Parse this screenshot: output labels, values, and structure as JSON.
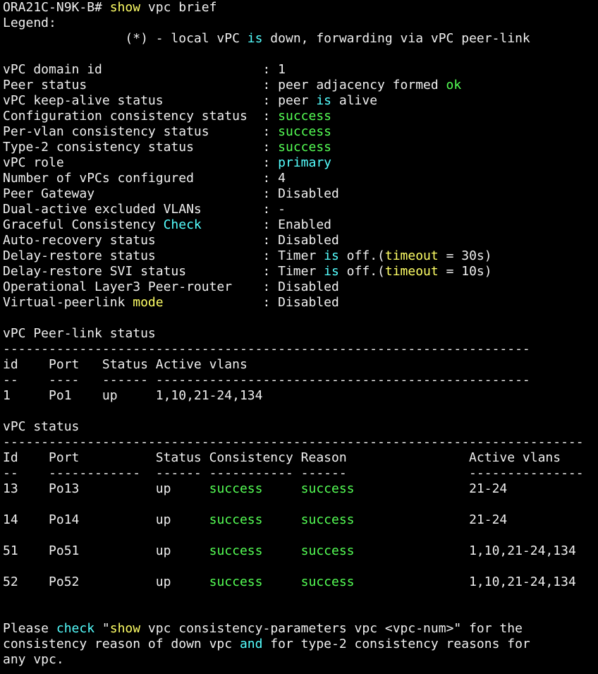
{
  "colors": {
    "background": "#000000",
    "text": "#f0f0f0",
    "keyword_yellow": "#ffff66",
    "keyword_green": "#55ff55",
    "keyword_cyan": "#55ffff"
  },
  "lines": [
    [
      {
        "t": "ORA21C-N9K-B# "
      },
      {
        "t": "show",
        "c": "y"
      },
      {
        "t": " vpc brief"
      }
    ],
    [
      {
        "t": "Legend:"
      }
    ],
    [
      {
        "t": "                (*) - local vPC "
      },
      {
        "t": "is",
        "c": "c"
      },
      {
        "t": " down, forwarding via vPC peer-link"
      }
    ],
    [
      {
        "t": ""
      }
    ],
    [
      {
        "t": "vPC domain id                     : 1"
      }
    ],
    [
      {
        "t": "Peer status                       : peer adjacency formed "
      },
      {
        "t": "ok",
        "c": "g"
      }
    ],
    [
      {
        "t": "vPC keep-alive status             : peer "
      },
      {
        "t": "is",
        "c": "c"
      },
      {
        "t": " alive"
      }
    ],
    [
      {
        "t": "Configuration consistency status  : "
      },
      {
        "t": "success",
        "c": "g"
      }
    ],
    [
      {
        "t": "Per-vlan consistency status       : "
      },
      {
        "t": "success",
        "c": "g"
      }
    ],
    [
      {
        "t": "Type-2 consistency status         : "
      },
      {
        "t": "success",
        "c": "g"
      }
    ],
    [
      {
        "t": "vPC role                          : "
      },
      {
        "t": "primary",
        "c": "c"
      }
    ],
    [
      {
        "t": "Number of vPCs configured         : 4"
      }
    ],
    [
      {
        "t": "Peer Gateway                      : Disabled"
      }
    ],
    [
      {
        "t": "Dual-active excluded VLANs        : -"
      }
    ],
    [
      {
        "t": "Graceful Consistency "
      },
      {
        "t": "Check",
        "c": "c"
      },
      {
        "t": "        : Enabled"
      }
    ],
    [
      {
        "t": "Auto-recovery status              : Disabled"
      }
    ],
    [
      {
        "t": "Delay-restore status              : Timer "
      },
      {
        "t": "is",
        "c": "c"
      },
      {
        "t": " off.("
      },
      {
        "t": "timeout",
        "c": "y"
      },
      {
        "t": " = 30s)"
      }
    ],
    [
      {
        "t": "Delay-restore SVI status          : Timer "
      },
      {
        "t": "is",
        "c": "c"
      },
      {
        "t": " off.("
      },
      {
        "t": "timeout",
        "c": "y"
      },
      {
        "t": " = 10s)"
      }
    ],
    [
      {
        "t": "Operational Layer3 Peer-router    : Disabled"
      }
    ],
    [
      {
        "t": "Virtual-peerlink "
      },
      {
        "t": "mode",
        "c": "y"
      },
      {
        "t": "             : Disabled"
      }
    ],
    [
      {
        "t": ""
      }
    ],
    [
      {
        "t": "vPC Peer-link status"
      }
    ],
    [
      {
        "t": "---------------------------------------------------------------------"
      }
    ],
    [
      {
        "t": "id    Port   Status Active vlans"
      }
    ],
    [
      {
        "t": "--    ----   ------ -------------------------------------------------"
      }
    ],
    [
      {
        "t": "1     Po1    up     1,10,21-24,134"
      }
    ],
    [
      {
        "t": ""
      }
    ],
    [
      {
        "t": "vPC status"
      }
    ],
    [
      {
        "t": "----------------------------------------------------------------------------"
      }
    ],
    [
      {
        "t": "Id    Port          Status Consistency Reason                Active vlans"
      }
    ],
    [
      {
        "t": "--    ------------  ------ ----------- ------                ---------------"
      }
    ],
    [
      {
        "t": "13    Po13          up     "
      },
      {
        "t": "success",
        "c": "g"
      },
      {
        "t": "     "
      },
      {
        "t": "success",
        "c": "g"
      },
      {
        "t": "               21-24"
      }
    ],
    [
      {
        "t": ""
      }
    ],
    [
      {
        "t": "14    Po14          up     "
      },
      {
        "t": "success",
        "c": "g"
      },
      {
        "t": "     "
      },
      {
        "t": "success",
        "c": "g"
      },
      {
        "t": "               21-24"
      }
    ],
    [
      {
        "t": ""
      }
    ],
    [
      {
        "t": "51    Po51          up     "
      },
      {
        "t": "success",
        "c": "g"
      },
      {
        "t": "     "
      },
      {
        "t": "success",
        "c": "g"
      },
      {
        "t": "               1,10,21-24,134"
      }
    ],
    [
      {
        "t": ""
      }
    ],
    [
      {
        "t": "52    Po52          up     "
      },
      {
        "t": "success",
        "c": "g"
      },
      {
        "t": "     "
      },
      {
        "t": "success",
        "c": "g"
      },
      {
        "t": "               1,10,21-24,134"
      }
    ],
    [
      {
        "t": ""
      }
    ],
    [
      {
        "t": ""
      }
    ],
    [
      {
        "t": "Please "
      },
      {
        "t": "check",
        "c": "c"
      },
      {
        "t": " \""
      },
      {
        "t": "show",
        "c": "y"
      },
      {
        "t": " vpc consistency-parameters vpc <vpc-num>\" for the"
      }
    ],
    [
      {
        "t": "consistency reason of down vpc "
      },
      {
        "t": "and",
        "c": "c"
      },
      {
        "t": " for type-2 consistency reasons for"
      }
    ],
    [
      {
        "t": "any vpc."
      }
    ]
  ]
}
